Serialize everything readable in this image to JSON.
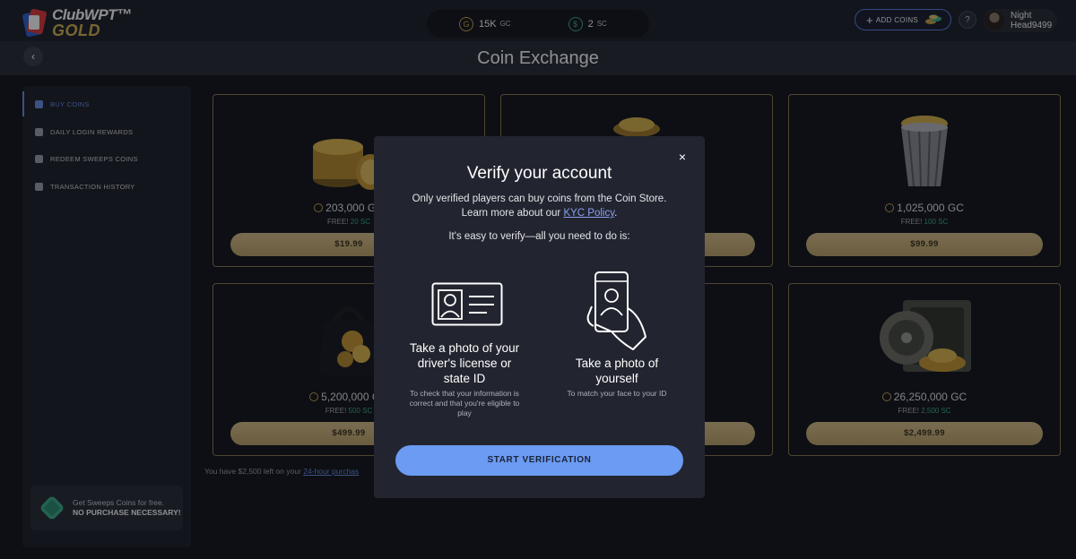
{
  "brand": {
    "line1": "ClubWPT™",
    "line2": "GOLD"
  },
  "balance": {
    "gc_icon": "G",
    "gc_value": "15K",
    "gc_unit": "GC",
    "sc_icon": "$",
    "sc_value": "2",
    "sc_unit": "SC"
  },
  "header_actions": {
    "add_coins_label": "ADD COINS",
    "help_glyph": "?"
  },
  "user": {
    "first": "Night",
    "last": "Head9499"
  },
  "page": {
    "title": "Coin Exchange",
    "back_glyph": "‹"
  },
  "sidebar": {
    "items": [
      {
        "label": "BUY COINS",
        "icon": "basket-icon",
        "active": true
      },
      {
        "label": "DAILY LOGIN REWARDS",
        "icon": "gift-icon",
        "active": false
      },
      {
        "label": "REDEEM SWEEPS COINS",
        "icon": "coins-icon",
        "active": false
      },
      {
        "label": "TRANSACTION HISTORY",
        "icon": "receipt-icon",
        "active": false
      }
    ],
    "promo": {
      "line1": "Get Sweeps Coins for free.",
      "line2": "NO PURCHASE NECESSARY!"
    }
  },
  "cards": [
    {
      "amount": "203,000 GC",
      "free_prefix": "FREE!",
      "free_sc": "20 SC",
      "price": "$19.99"
    },
    {
      "amount": "",
      "free_prefix": "",
      "free_sc": "",
      "price": ""
    },
    {
      "amount": "1,025,000 GC",
      "free_prefix": "FREE!",
      "free_sc": "100 SC",
      "price": "$99.99"
    },
    {
      "amount": "5,200,000 GC",
      "free_prefix": "FREE!",
      "free_sc": "500 SC",
      "price": "$499.99"
    },
    {
      "amount": "",
      "free_prefix": "",
      "free_sc": "",
      "price": ""
    },
    {
      "amount": "26,250,000 GC",
      "free_prefix": "FREE!",
      "free_sc": "2,500 SC",
      "price": "$2,499.99"
    }
  ],
  "limit_note": {
    "text": "You have $2,500 left on your",
    "link": "24-hour purchas"
  },
  "modal": {
    "close_glyph": "×",
    "title": "Verify your account",
    "desc_text": "Only verified players can buy coins from the Coin Store. Learn more about our",
    "desc_link": "KYC Policy",
    "desc_end": ".",
    "easy": "It's easy to verify—all you need to do is:",
    "step1": {
      "title": "Take a photo of your driver's license or state ID",
      "desc": "To check that your information is correct and that you're eligible to play"
    },
    "step2": {
      "title": "Take a photo of yourself",
      "desc": "To match your face to your ID"
    },
    "button": "START VERIFICATION"
  },
  "colors": {
    "accent_blue": "#6b9bf2",
    "gold": "#c9a64b",
    "sc_green": "#3fb08b",
    "bg": "#14161d"
  }
}
